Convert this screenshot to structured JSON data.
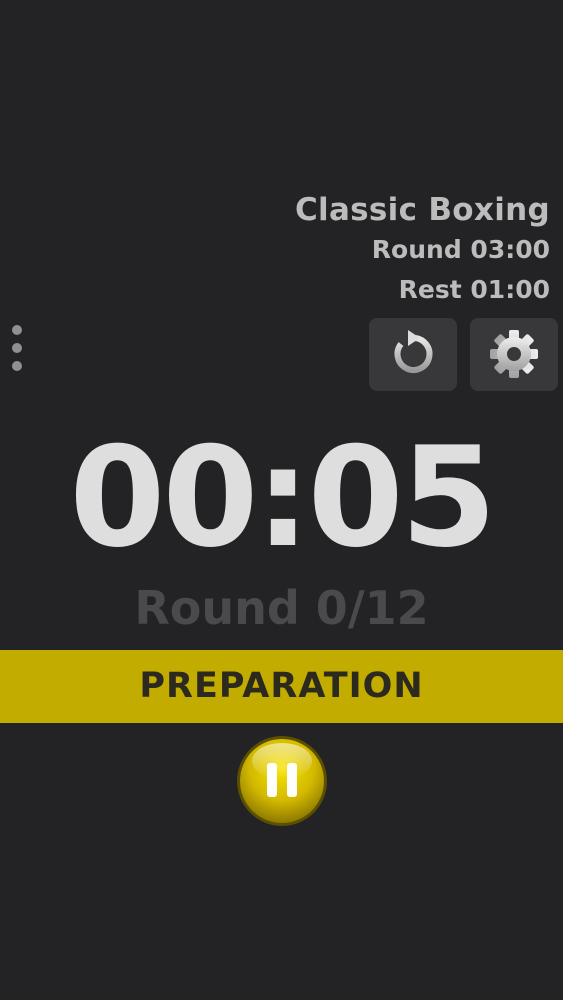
{
  "workout": {
    "title": "Classic Boxing",
    "round_duration": "Round 03:00",
    "rest_duration": "Rest 01:00"
  },
  "timer": {
    "time": "00:05",
    "round_counter": "Round 0/12"
  },
  "phase": {
    "label": "PREPARATION",
    "color": "#c3ac00"
  },
  "icons": {
    "menu": "more-vertical-icon",
    "reset": "reset-icon",
    "settings": "gear-icon",
    "pause": "pause-icon"
  },
  "colors": {
    "background": "#232224",
    "button": "#38373a",
    "accent": "#c3ac00"
  }
}
